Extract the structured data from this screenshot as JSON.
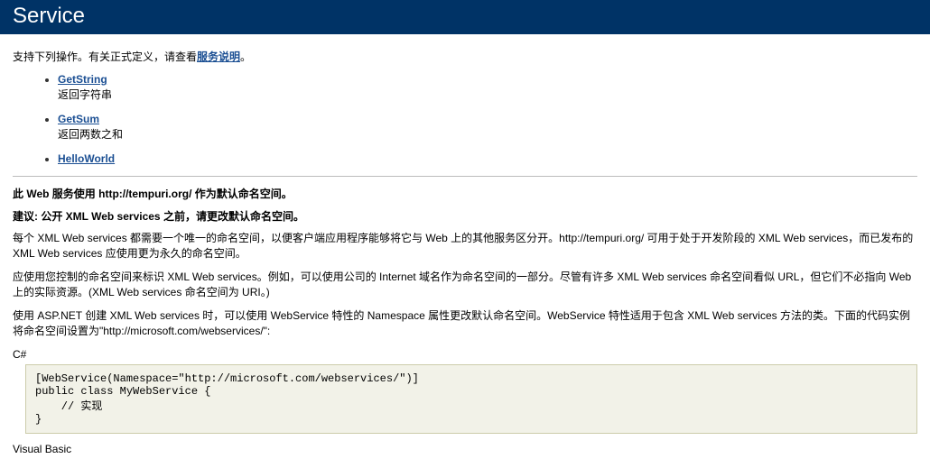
{
  "header": {
    "title": "Service"
  },
  "intro": {
    "prefix": "支持下列操作。有关正式定义，请查看",
    "link": "服务说明",
    "suffix": "。"
  },
  "operations": [
    {
      "name": "GetString",
      "desc": "返回字符串"
    },
    {
      "name": "GetSum",
      "desc": "返回两数之和"
    },
    {
      "name": "HelloWorld",
      "desc": ""
    }
  ],
  "notice": {
    "line1": "此 Web 服务使用 http://tempuri.org/ 作为默认命名空间。",
    "line2": "建议: 公开 XML Web services 之前，请更改默认命名空间。"
  },
  "paragraphs": [
    "每个 XML Web services 都需要一个唯一的命名空间，以便客户端应用程序能够将它与 Web 上的其他服务区分开。http://tempuri.org/ 可用于处于开发阶段的 XML Web services，而已发布的 XML Web services 应使用更为永久的命名空间。",
    "应使用您控制的命名空间来标识 XML Web services。例如，可以使用公司的 Internet 域名作为命名空间的一部分。尽管有许多 XML Web services 命名空间看似 URL，但它们不必指向 Web 上的实际资源。(XML Web services 命名空间为 URI。)",
    "使用 ASP.NET 创建 XML Web services 时，可以使用 WebService 特性的 Namespace 属性更改默认命名空间。WebService 特性适用于包含 XML Web services 方法的类。下面的代码实例将命名空间设置为\"http://microsoft.com/webservices/\":"
  ],
  "code": {
    "csharp_label": "C#",
    "csharp": "[WebService(Namespace=\"http://microsoft.com/webservices/\")]\npublic class MyWebService {\n    // 实现\n}",
    "vb_label": "Visual Basic"
  }
}
